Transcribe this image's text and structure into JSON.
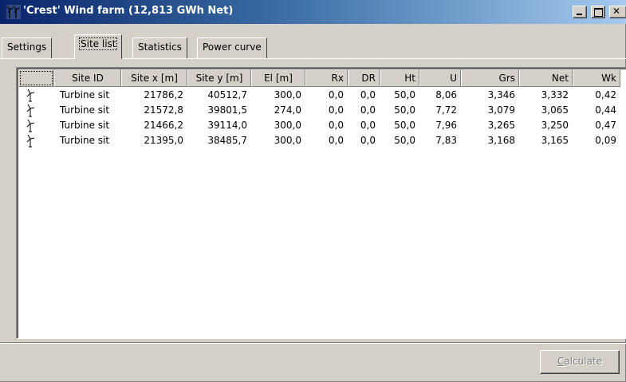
{
  "window": {
    "title": "'Crest' Wind farm (12,813 GWh Net)",
    "controls": [
      "minimize",
      "maximize",
      "close"
    ]
  },
  "tabs": [
    {
      "label": "Settings",
      "active": false
    },
    {
      "label": "Site list",
      "active": true
    },
    {
      "label": "Statistics",
      "active": false
    },
    {
      "label": "Power curve",
      "active": false
    }
  ],
  "table": {
    "columns": [
      "",
      "Site ID",
      "Site x [m]",
      "Site y [m]",
      "El [m]",
      "Rx",
      "DR",
      "Ht",
      "U",
      "Grs",
      "Net",
      "Wk"
    ],
    "rows": [
      [
        "Turbine sit",
        "21786,2",
        "40512,7",
        "300,0",
        "0,0",
        "0,0",
        "50,0",
        "8,06",
        "3,346",
        "3,332",
        "0,42"
      ],
      [
        "Turbine sit",
        "21572,8",
        "39801,5",
        "274,0",
        "0,0",
        "0,0",
        "50,0",
        "7,72",
        "3,079",
        "3,065",
        "0,44"
      ],
      [
        "Turbine sit",
        "21466,2",
        "39114,0",
        "300,0",
        "0,0",
        "0,0",
        "50,0",
        "7,96",
        "3,265",
        "3,250",
        "0,47"
      ],
      [
        "Turbine sit",
        "21395,0",
        "38485,7",
        "300,0",
        "0,0",
        "0,0",
        "50,0",
        "7,83",
        "3,168",
        "3,165",
        "0,09"
      ]
    ],
    "row_icon": "wind-turbine-icon"
  },
  "buttons": {
    "calculate": "Calculate",
    "calculate_enabled": false
  },
  "colors": {
    "title_gradient_start": "#0a246a",
    "title_gradient_end": "#a6caf0",
    "face": "#d4d0c8"
  }
}
